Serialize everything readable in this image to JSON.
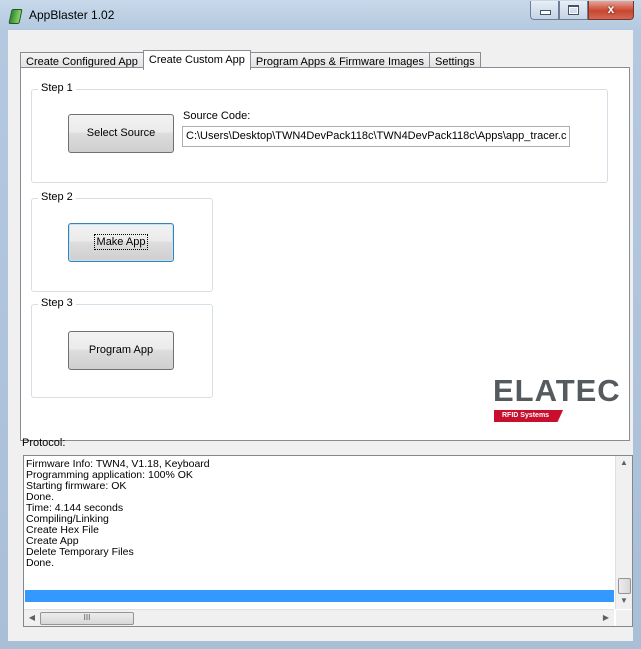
{
  "window": {
    "title": "AppBlaster 1.02",
    "close_glyph": "x"
  },
  "tabs": [
    {
      "label": "Create Configured App"
    },
    {
      "label": "Create Custom App"
    },
    {
      "label": "Program Apps & Firmware Images"
    },
    {
      "label": "Settings"
    }
  ],
  "active_tab": "Create Custom App",
  "step1": {
    "title": "Step 1",
    "select_source_label": "Select Source",
    "source_code_label": "Source Code:",
    "source_code_value": "C:\\Users\\Desktop\\TWN4DevPack118c\\TWN4DevPack118c\\Apps\\app_tracer.c"
  },
  "step2": {
    "title": "Step 2",
    "make_app_label": "Make App"
  },
  "step3": {
    "title": "Step 3",
    "program_app_label": "Program App"
  },
  "logo": {
    "name": "ELATEC",
    "tagline": "RFID Systems",
    "accent_color": "#c8102e"
  },
  "protocol": {
    "label": "Protocol:",
    "lines": [
      "Firmware Info: TWN4, V1.18, Keyboard",
      "Programming application: 100% OK",
      "Starting firmware: OK",
      "Done.",
      "Time: 4.144 seconds",
      "Compiling/Linking",
      "Create Hex File",
      "Create App",
      "Delete Temporary Files",
      "Done.",
      ""
    ],
    "selected_color": "#3399ff",
    "hscroll_grip": "III"
  },
  "icons": [
    "app-icon",
    "minimize-icon",
    "maximize-icon",
    "close-icon",
    "scroll-up-arrow-icon",
    "scroll-down-arrow-icon",
    "scroll-left-arrow-icon",
    "scroll-right-arrow-icon"
  ]
}
